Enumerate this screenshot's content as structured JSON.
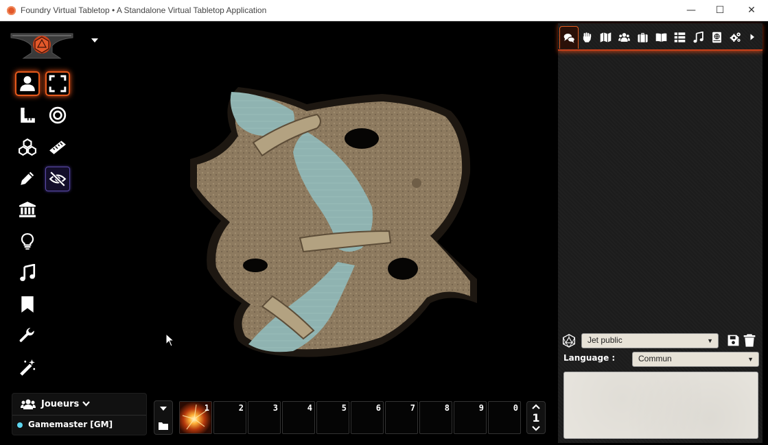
{
  "window": {
    "title": "Foundry Virtual Tabletop • A Standalone Virtual Tabletop Application",
    "controls": {
      "minimize": "—",
      "maximize": "☐",
      "close": "✕"
    }
  },
  "scene_controls": [
    {
      "name": "token-controls",
      "icon": "user-icon",
      "active": true
    },
    {
      "name": "measure-controls",
      "icon": "ruler-triangle-icon"
    },
    {
      "name": "tile-controls",
      "icon": "cubes-icon"
    },
    {
      "name": "drawing-controls",
      "icon": "pencil-icon"
    },
    {
      "name": "wall-controls",
      "icon": "building-columns-icon"
    },
    {
      "name": "lighting-controls",
      "icon": "lightbulb-icon"
    },
    {
      "name": "sound-controls",
      "icon": "music-icon"
    },
    {
      "name": "note-controls",
      "icon": "bookmark-icon"
    },
    {
      "name": "settings-controls",
      "icon": "wrench-icon"
    },
    {
      "name": "magic-controls",
      "icon": "magic-wand-icon"
    }
  ],
  "sub_tools": [
    {
      "name": "select-tool",
      "icon": "expand-icon",
      "active": true
    },
    {
      "name": "target-tool",
      "icon": "bullseye-icon"
    },
    {
      "name": "ruler-tool",
      "icon": "ruler-icon"
    },
    {
      "name": "visibility-tool",
      "icon": "eye-slash-icon",
      "toggled": true
    }
  ],
  "players": {
    "label": "Joueurs",
    "list": [
      {
        "name": "Gamemaster [GM]",
        "color": "#5dd6f0"
      }
    ]
  },
  "hotbar": {
    "slots": [
      "1",
      "2",
      "3",
      "4",
      "5",
      "6",
      "7",
      "8",
      "9",
      "0"
    ],
    "page": "1"
  },
  "sidebar": {
    "tabs": [
      {
        "name": "chat",
        "icon": "comments-icon",
        "active": true
      },
      {
        "name": "combat",
        "icon": "fist-raised-icon"
      },
      {
        "name": "scenes",
        "icon": "map-icon"
      },
      {
        "name": "actors",
        "icon": "users-icon"
      },
      {
        "name": "items",
        "icon": "suitcase-icon"
      },
      {
        "name": "journal",
        "icon": "book-open-icon"
      },
      {
        "name": "tables",
        "icon": "th-list-icon"
      },
      {
        "name": "playlists",
        "icon": "music-icon"
      },
      {
        "name": "compendium",
        "icon": "atlas-icon"
      },
      {
        "name": "settings",
        "icon": "cogs-icon"
      },
      {
        "name": "collapse",
        "icon": "caret-right-icon"
      }
    ],
    "chat": {
      "roll_mode": "Jet public",
      "language_label": "Language :",
      "language": "Commun",
      "message": ""
    }
  },
  "colors": {
    "accent": "#e55a1c",
    "sidebar_bg": "#1c1c1c",
    "player_dot": "#5dd6f0"
  }
}
